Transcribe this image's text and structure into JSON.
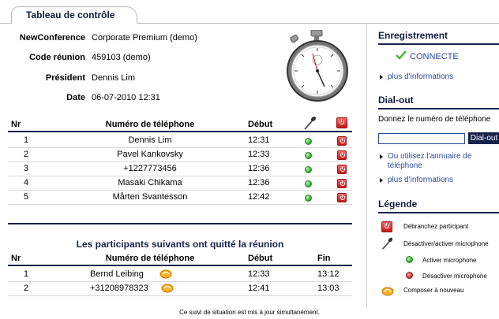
{
  "tab": {
    "label": "Tableau de contrôle"
  },
  "info": [
    {
      "key": "NewConference",
      "value": "Corporate Premium (demo)"
    },
    {
      "key": "Code réunion",
      "value": "459103 (demo)"
    },
    {
      "key": "Président",
      "value": "Dennis Lim"
    },
    {
      "key": "Date",
      "value": "06-07-2010 12:31"
    }
  ],
  "active_table": {
    "headers": {
      "nr": "Nr",
      "phone": "Numéro de téléphone",
      "start": "Début"
    },
    "rows": [
      {
        "nr": "1",
        "name": "Dennis Lim",
        "start": "12:31"
      },
      {
        "nr": "2",
        "name": "Pavel Kankovsky",
        "start": "12:33"
      },
      {
        "nr": "3",
        "name": "+1227773456",
        "start": "12:36"
      },
      {
        "nr": "4",
        "name": "Masaki Chikama",
        "start": "12:36"
      },
      {
        "nr": "5",
        "name": "Mårten Svantesson",
        "start": "12:42"
      }
    ]
  },
  "left_section": {
    "title": "Les participants suivants ont quitté la réunion",
    "headers": {
      "nr": "Nr",
      "phone": "Numéro de téléphone",
      "start": "Début",
      "end": "Fin"
    },
    "rows": [
      {
        "nr": "1",
        "name": "Bernd Leibing",
        "start": "12:33",
        "end": "13:12"
      },
      {
        "nr": "2",
        "name": "+31208978323",
        "start": "12:41",
        "end": "13:03"
      }
    ]
  },
  "footer": "Ce suivi de situation est mis à jour simultanément.",
  "sidebar": {
    "recording": {
      "title": "Enregistrement",
      "status": "CONNECTE",
      "more": "plus d'informations"
    },
    "dialout": {
      "title": "Dial-out",
      "prompt": "Donnez le numéro de téléphone",
      "input_value": "",
      "button": "Dial-out",
      "directory_line1": "Ou utilisez l'annuaire de",
      "directory_line2": "téléphone",
      "more": "plus d'informations"
    },
    "legend": {
      "title": "Légende",
      "items": [
        "Débranchez participant",
        "Désactiver/activer microphone",
        "Activer microphone",
        "Désactiver microphone",
        "Composer à nouveau"
      ]
    }
  },
  "colors": {
    "navy": "#16224a",
    "link": "#2a4a9a",
    "green": "#2ea32a",
    "red": "#c81616"
  }
}
